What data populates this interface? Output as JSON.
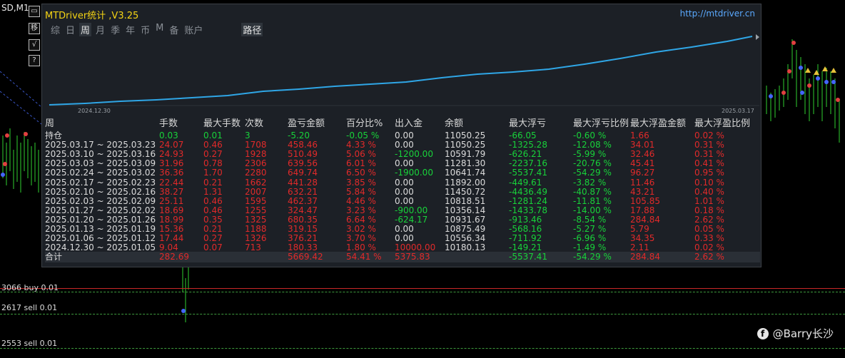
{
  "chart": {
    "symbol": "SD,M1",
    "tool_buttons": [
      "▭",
      "移",
      "√",
      "?"
    ],
    "levels": [
      {
        "label": "3066 buy 0.01"
      },
      {
        "label": "2617 sell 0.01"
      },
      {
        "label": "2553 sell 0.01"
      }
    ]
  },
  "panel": {
    "title": "MTDriver统计 ,V3.25",
    "url": "http://mtdriver.cn",
    "tabs": [
      "综",
      "日",
      "周",
      "月",
      "季",
      "年",
      "币",
      "M",
      "备",
      "账户"
    ],
    "active_tab": "周",
    "path_tab": "路径",
    "curve": {
      "start_date": "2024.12.30",
      "end_date": "2025.03.17"
    }
  },
  "table": {
    "headers": [
      "周",
      "手数",
      "最大手数",
      "次数",
      "盈亏金额",
      "百分比%",
      "出入金",
      "余额",
      "最大浮亏",
      "最大浮亏比例",
      "最大浮盈金额",
      "最大浮盈比例"
    ],
    "rows": [
      [
        "持仓",
        "0.03",
        "0.01",
        "3",
        "-5.20",
        "-0.05 %",
        "0.00",
        "11050.25",
        "-66.05",
        "-0.60 %",
        "1.66",
        "0.02 %"
      ],
      [
        "2025.03.17 ~ 2025.03.23",
        "24.07",
        "0.46",
        "1708",
        "458.46",
        "4.33 %",
        "0.00",
        "11050.25",
        "-1325.28",
        "-12.08 %",
        "34.01",
        "0.31 %"
      ],
      [
        "2025.03.10 ~ 2025.03.16",
        "24.93",
        "0.27",
        "1928",
        "510.49",
        "5.06 %",
        "-1200.00",
        "10591.79",
        "-626.21",
        "-5.99 %",
        "32.46",
        "0.31 %"
      ],
      [
        "2025.03.03 ~ 2025.03.09",
        "31.96",
        "0.78",
        "2306",
        "639.56",
        "6.01 %",
        "0.00",
        "11281.30",
        "-2237.16",
        "-20.76 %",
        "45.41",
        "0.41 %"
      ],
      [
        "2025.02.24 ~ 2025.03.02",
        "36.36",
        "1.70",
        "2280",
        "649.74",
        "6.50 %",
        "-1900.00",
        "10641.74",
        "-5537.41",
        "-54.29 %",
        "96.27",
        "0.95 %"
      ],
      [
        "2025.02.17 ~ 2025.02.23",
        "22.44",
        "0.21",
        "1662",
        "441.28",
        "3.85 %",
        "0.00",
        "11892.00",
        "-449.61",
        "-3.82 %",
        "11.46",
        "0.10 %"
      ],
      [
        "2025.02.10 ~ 2025.02.16",
        "38.27",
        "1.31",
        "2007",
        "632.21",
        "5.84 %",
        "0.00",
        "11450.72",
        "-4436.49",
        "-40.87 %",
        "43.21",
        "0.40 %"
      ],
      [
        "2025.02.03 ~ 2025.02.09",
        "25.11",
        "0.46",
        "1595",
        "462.37",
        "4.46 %",
        "0.00",
        "10818.51",
        "-1281.24",
        "-11.81 %",
        "105.85",
        "1.01 %"
      ],
      [
        "2025.01.27 ~ 2025.02.02",
        "18.69",
        "0.46",
        "1255",
        "324.47",
        "3.23 %",
        "-900.00",
        "10356.14",
        "-1433.78",
        "-14.00 %",
        "17.88",
        "0.18 %"
      ],
      [
        "2025.01.20 ~ 2025.01.26",
        "18.99",
        "0.35",
        "1325",
        "680.35",
        "6.64 %",
        "-624.17",
        "10931.67",
        "-913.46",
        "-8.54 %",
        "284.84",
        "2.62 %"
      ],
      [
        "2025.01.13 ~ 2025.01.19",
        "15.36",
        "0.21",
        "1188",
        "319.15",
        "3.02 %",
        "0.00",
        "10875.49",
        "-568.16",
        "-5.27 %",
        "5.79",
        "0.05 %"
      ],
      [
        "2025.01.06 ~ 2025.01.12",
        "17.44",
        "0.27",
        "1326",
        "376.21",
        "3.70 %",
        "0.00",
        "10556.34",
        "-711.92",
        "-6.96 %",
        "34.35",
        "0.33 %"
      ],
      [
        "2024.12.30 ~ 2025.01.05",
        "9.04",
        "0.07",
        "713",
        "180.33",
        "1.80 %",
        "10000.00",
        "10180.13",
        "-149.21",
        "-1.49 %",
        "2.11",
        "0.02 %"
      ],
      [
        "合计",
        "282.69",
        "",
        "",
        "5669.42",
        "54.41 %",
        "5375.83",
        "",
        "-5537.41",
        "-54.29 %",
        "284.84",
        "2.62 %"
      ]
    ]
  },
  "watermark": "@Barry长沙"
}
